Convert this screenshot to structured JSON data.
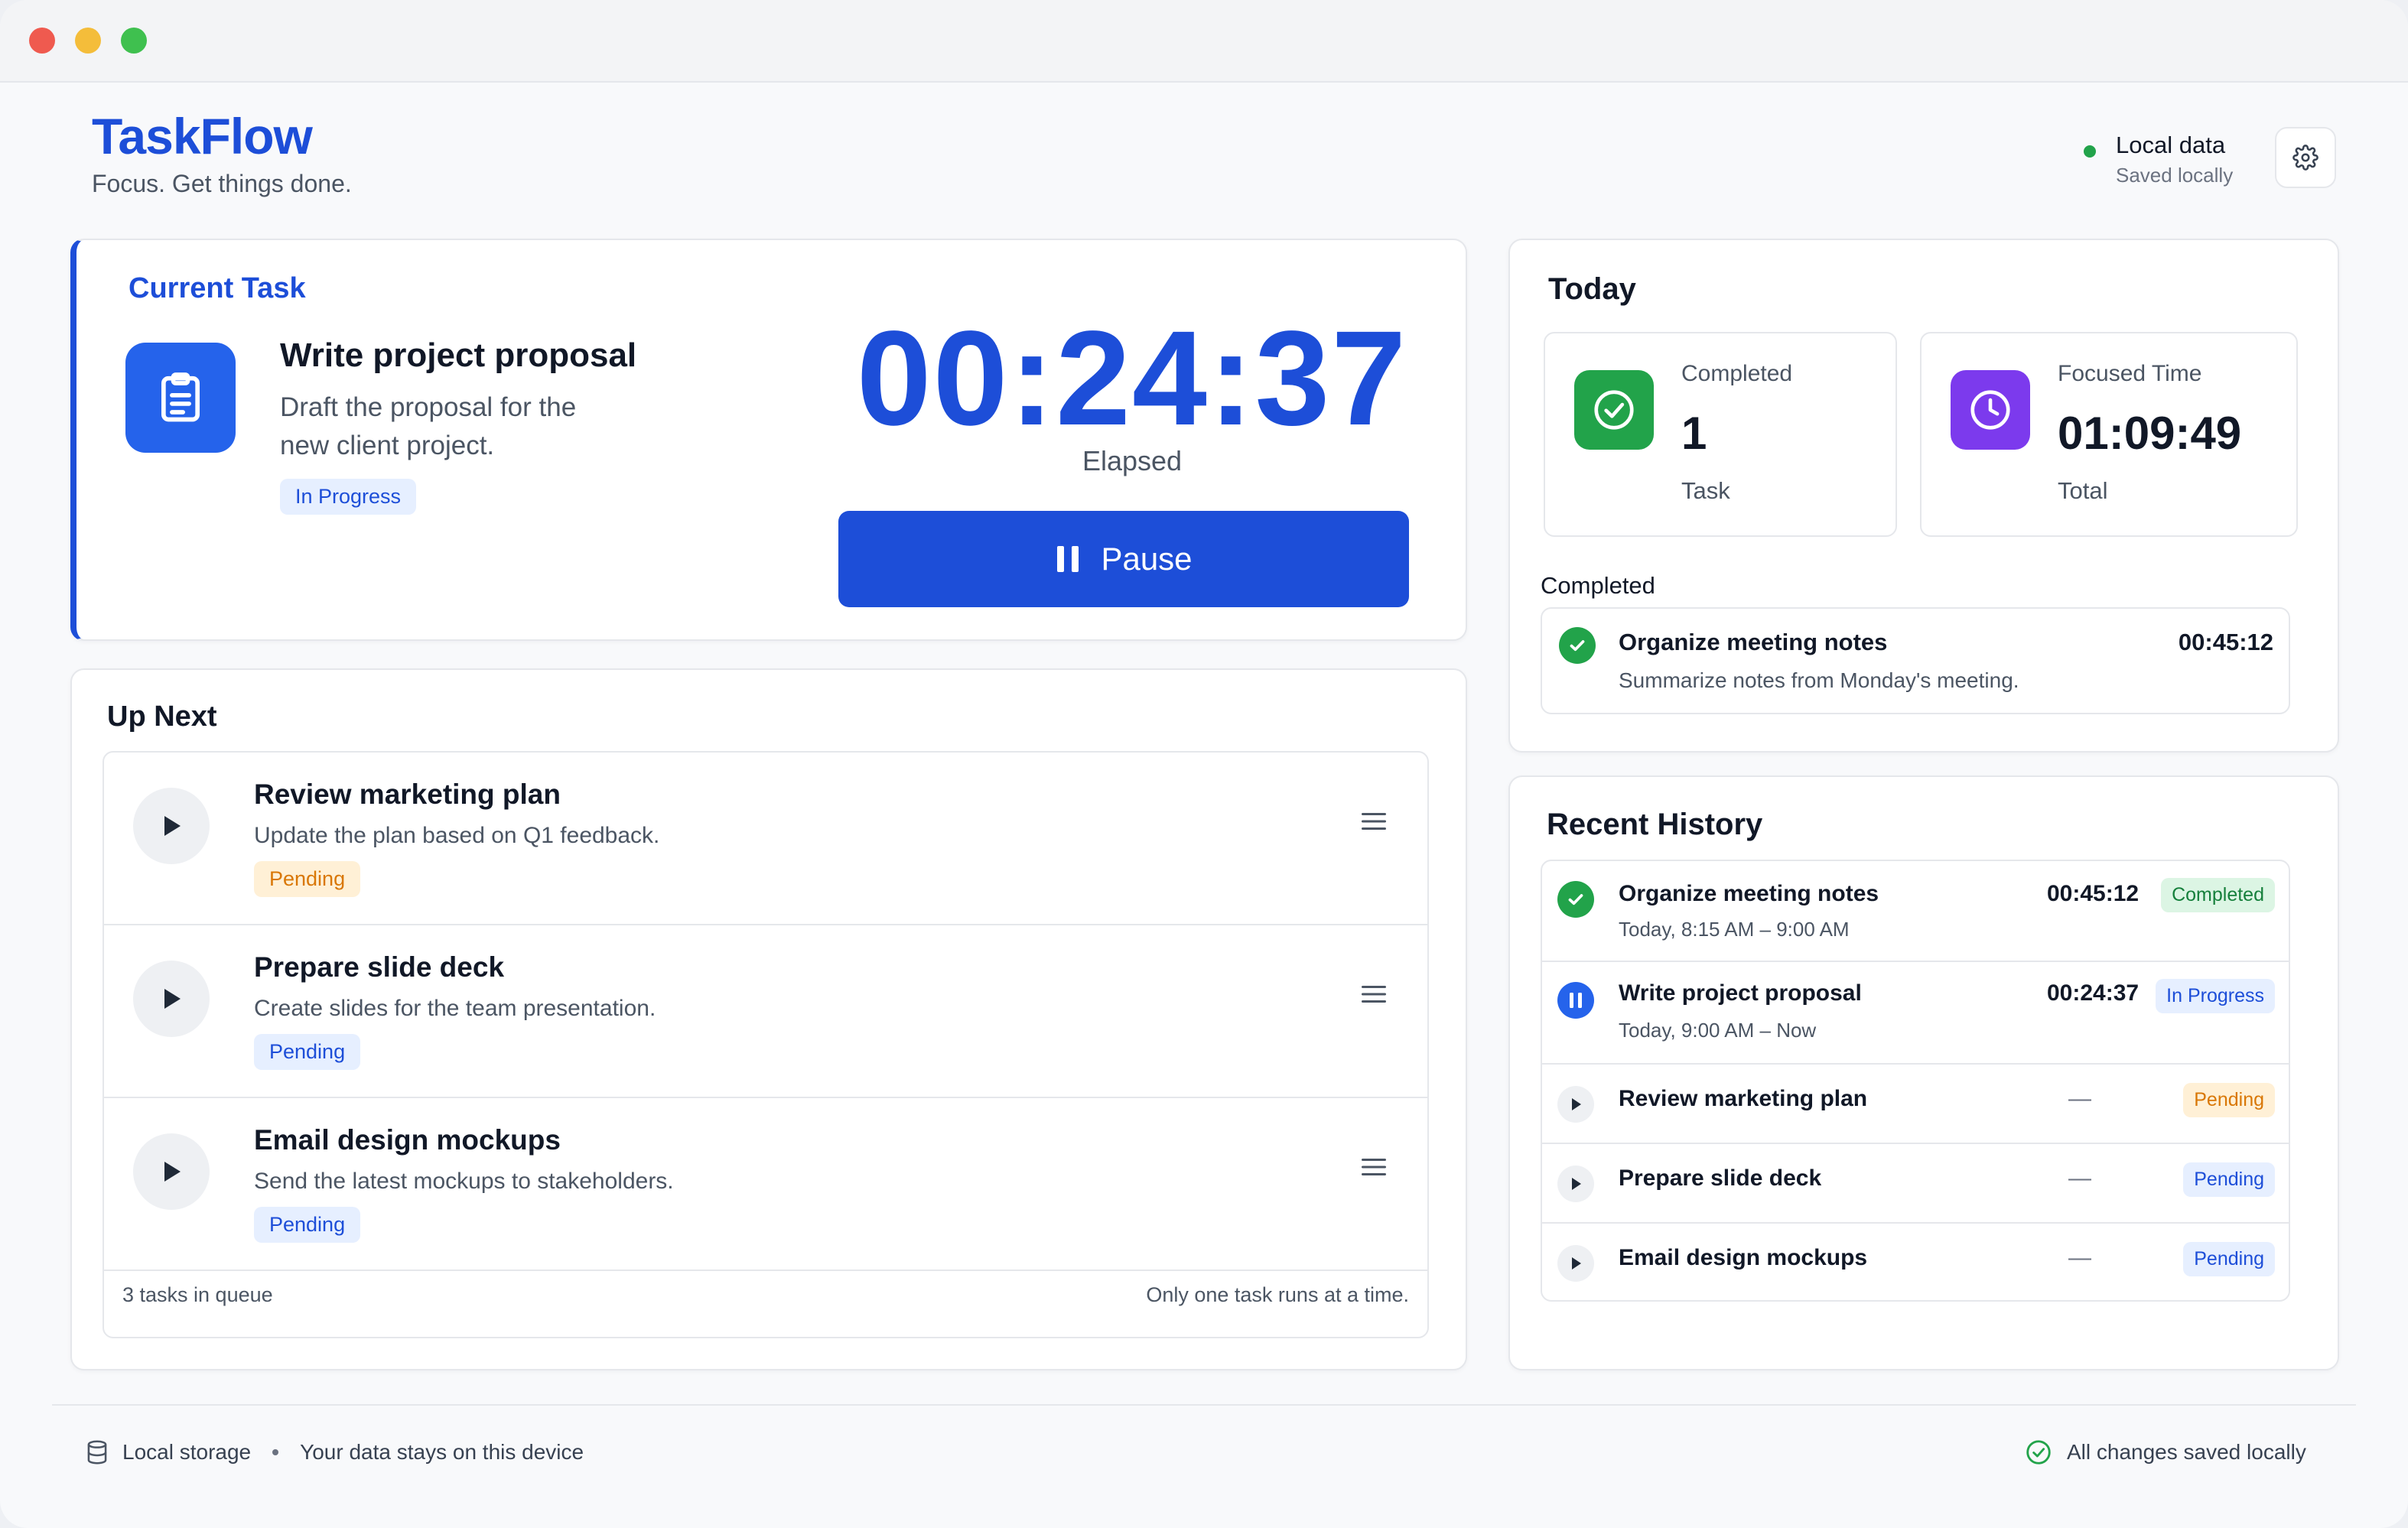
{
  "brand": {
    "title": "TaskFlow",
    "subtitle": "Focus. Get things done."
  },
  "local_status": {
    "title": "Local data",
    "subtitle": "Saved locally",
    "dot_color": "#22a34a"
  },
  "current_task": {
    "section_label": "Current Task",
    "title": "Write project proposal",
    "description": "Draft the proposal for the new client project.",
    "status": "In Progress",
    "timer": "00:24:37",
    "timer_label": "Elapsed",
    "pause_label": "Pause"
  },
  "up_next": {
    "section_label": "Up Next",
    "items": [
      {
        "title": "Review marketing plan",
        "description": "Update the plan based on Q1 feedback.",
        "status": "Pending",
        "status_style": "orange"
      },
      {
        "title": "Prepare slide deck",
        "description": "Create slides for the team presentation.",
        "status": "Pending",
        "status_style": "blue"
      },
      {
        "title": "Email design mockups",
        "description": "Send the latest mockups to stakeholders.",
        "status": "Pending",
        "status_style": "blue"
      }
    ],
    "footer_left": "3 tasks in queue",
    "footer_right": "Only one task runs at a time."
  },
  "today": {
    "section_label": "Today",
    "completed_stat": {
      "label": "Completed",
      "value": "1",
      "unit": "Task"
    },
    "focused_stat": {
      "label": "Focused Time",
      "value": "01:09:49",
      "unit": "Total"
    },
    "completed_label": "Completed",
    "completed_item": {
      "title": "Organize meeting notes",
      "description": "Summarize notes from Monday's meeting.",
      "time": "00:45:12"
    }
  },
  "history": {
    "section_label": "Recent History",
    "rows": [
      {
        "title": "Organize meeting notes",
        "subtitle": "Today, 8:15 AM – 9:00 AM",
        "duration": "00:45:12",
        "status": "Completed",
        "icon": "check-icon"
      },
      {
        "title": "Write project proposal",
        "subtitle": "Today, 9:00 AM – Now",
        "duration": "00:24:37",
        "status": "In Progress",
        "icon": "pause-icon"
      },
      {
        "title": "Review marketing plan",
        "duration": "—",
        "status": "Pending",
        "icon": "play-icon"
      },
      {
        "title": "Prepare slide deck",
        "duration": "—",
        "status": "Pending",
        "icon": "play-icon"
      },
      {
        "title": "Email design mockups",
        "duration": "—",
        "status": "Pending",
        "icon": "play-icon"
      }
    ]
  },
  "footer": {
    "storage_label": "Local storage",
    "storage_note": "Your data stays on this device",
    "saved_label": "All changes saved locally"
  },
  "colors": {
    "accent": "#1d4ed8",
    "success": "#22a34a",
    "warning": "#d97706",
    "purple": "#7c3aed"
  }
}
